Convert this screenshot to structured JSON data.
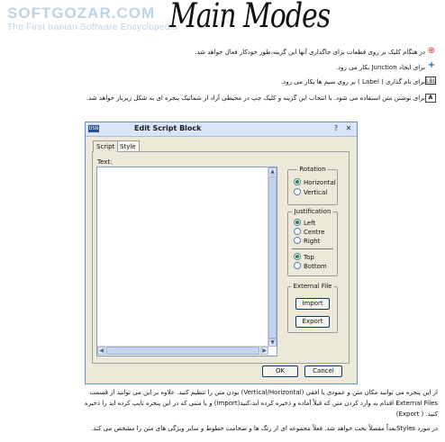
{
  "watermark": {
    "main": "SOFTGOZAR.COM",
    "sub": "The First Iranian Software Encyclopedia"
  },
  "title": "Main Modes",
  "bullets": [
    {
      "icon": "split-icon",
      "text": "در هنگام کلیک بر روی قطعات بزای جاگذاری آنها این گزینه،طور خودکار فعال خواهد شد."
    },
    {
      "icon": "junction-icon",
      "text": "برای ایجاد Junction بکار می رود."
    },
    {
      "icon": "label-icon",
      "text": "برای نام گذاری ( Label ) بر روی سیم ها بکار می رود."
    },
    {
      "icon": "text-icon",
      "text": "برای نوشتن متن استفاده می شود. با انتخاب این گزینه و کلیک چپ در محیطی آزاد از شماتیک پنجره ای به شکل زیرباز خواهد شد."
    }
  ],
  "dialog": {
    "app_icon": "DSN",
    "title": "Edit Script Block",
    "help_glyph": "?",
    "close_glyph": "✕",
    "tabs": [
      {
        "label": "Script",
        "active": true
      },
      {
        "label": "Style",
        "active": false
      }
    ],
    "text_label": "Text:",
    "text_value": "",
    "rotation": {
      "title": "Rotation",
      "options": [
        "Horizontal",
        "Vertical"
      ],
      "selected": "Horizontal"
    },
    "justification": {
      "title": "Justification",
      "horizontal_options": [
        "Left",
        "Centre",
        "Right"
      ],
      "horizontal_selected": "Left",
      "vertical_options": [
        "Top",
        "Bottom"
      ],
      "vertical_selected": "Top"
    },
    "external_file": {
      "title": "External File",
      "import_label": "Import",
      "export_label": "Export"
    },
    "ok_label": "OK",
    "cancel_label": "Cancel"
  },
  "paragraphs": [
    "از این پنجره می توانید مکان متن و عمودی یا افقی (Vertical/Horizontal) بودن متن را تنظیم کنید. علاوه بر این می توانید از قسمت",
    "External Files اقدام به وارد کردن متن که قبلاً آماده و ذخیره کرده اید،کنید(Import) و یا متنی که در این پنجره تایپ کرده اید را ذخیره",
    "کنید. ( Export)",
    "در مورد Stylesبعداً مفصلاً بحث خواهد شد. فعلاً مجموعه ای از رنگ ها و ضخامت خطوط و سایر ویژگی های متن را مشخص می کند."
  ]
}
